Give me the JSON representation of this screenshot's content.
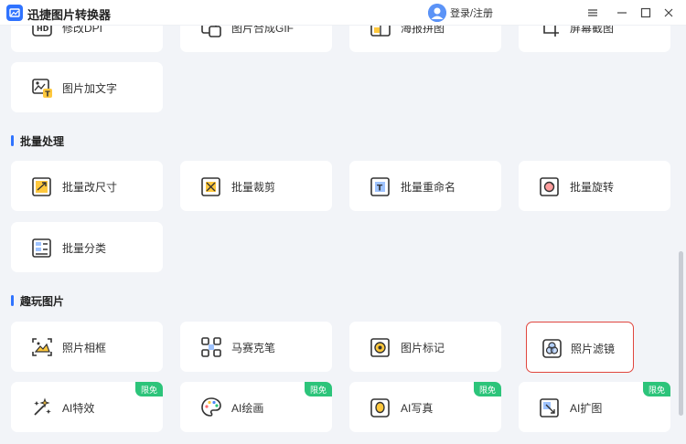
{
  "app": {
    "title": "迅捷图片转换器",
    "login_label": "登录/注册"
  },
  "top_row": [
    {
      "label": "修改DPI",
      "icon": "hd-icon"
    },
    {
      "label": "图片合成GIF",
      "icon": "gif-icon"
    },
    {
      "label": "海报拼图",
      "icon": "collage-icon"
    },
    {
      "label": "屏幕截图",
      "icon": "screenshot-icon"
    }
  ],
  "add_text": {
    "label": "图片加文字",
    "icon": "image-text-icon"
  },
  "batch": {
    "title": "批量处理",
    "items": [
      {
        "label": "批量改尺寸",
        "icon": "resize-icon"
      },
      {
        "label": "批量裁剪",
        "icon": "crop-icon"
      },
      {
        "label": "批量重命名",
        "icon": "rename-icon"
      },
      {
        "label": "批量旋转",
        "icon": "rotate-icon"
      },
      {
        "label": "批量分类",
        "icon": "classify-icon"
      }
    ]
  },
  "fun": {
    "title": "趣玩图片",
    "items": [
      {
        "label": "照片相框",
        "icon": "frame-icon"
      },
      {
        "label": "马赛克笔",
        "icon": "mosaic-icon"
      },
      {
        "label": "图片标记",
        "icon": "mark-icon"
      },
      {
        "label": "照片滤镜",
        "icon": "filter-icon"
      }
    ]
  },
  "ai": {
    "badge": "限免",
    "items": [
      {
        "label": "AI特效",
        "icon": "sparkle-icon"
      },
      {
        "label": "AI绘画",
        "icon": "palette-icon"
      },
      {
        "label": "AI写真",
        "icon": "portrait-icon"
      },
      {
        "label": "AI扩图",
        "icon": "expand-icon"
      }
    ]
  },
  "colors": {
    "accent": "#2f73ff",
    "highlight_border": "#e0463e",
    "badge": "#2cc47a"
  }
}
